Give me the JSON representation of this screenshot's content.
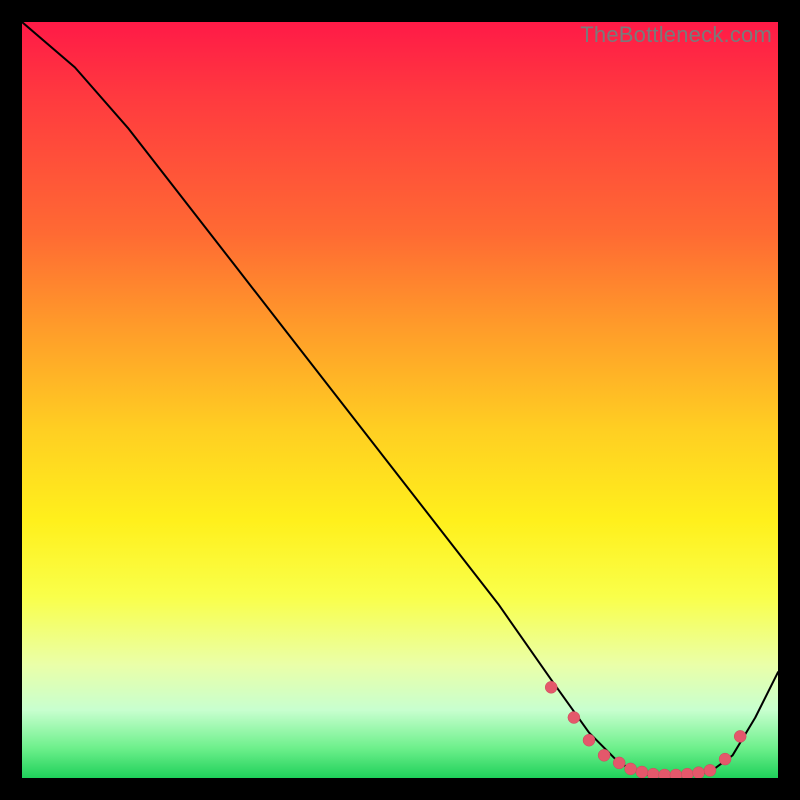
{
  "watermark": "TheBottleneck.com",
  "chart_data": {
    "type": "line",
    "title": "",
    "xlabel": "",
    "ylabel": "",
    "xlim": [
      0,
      100
    ],
    "ylim": [
      0,
      100
    ],
    "series": [
      {
        "name": "curve",
        "x": [
          0,
          7,
          14,
          21,
          28,
          35,
          42,
          49,
          56,
          63,
          70,
          75,
          79,
          82,
          85,
          88,
          91,
          94,
          97,
          100
        ],
        "y": [
          100,
          94,
          86,
          77,
          68,
          59,
          50,
          41,
          32,
          23,
          13,
          6,
          2,
          0.5,
          0.3,
          0.4,
          0.8,
          3,
          8,
          14
        ]
      }
    ],
    "markers": {
      "name": "highlight-band",
      "x": [
        70,
        73,
        75,
        77,
        79,
        80.5,
        82,
        83.5,
        85,
        86.5,
        88,
        89.5,
        91,
        93,
        95
      ],
      "y": [
        12,
        8,
        5,
        3,
        2,
        1.2,
        0.8,
        0.5,
        0.4,
        0.4,
        0.5,
        0.7,
        1.0,
        2.5,
        5.5
      ],
      "color": "#e4586b"
    }
  }
}
